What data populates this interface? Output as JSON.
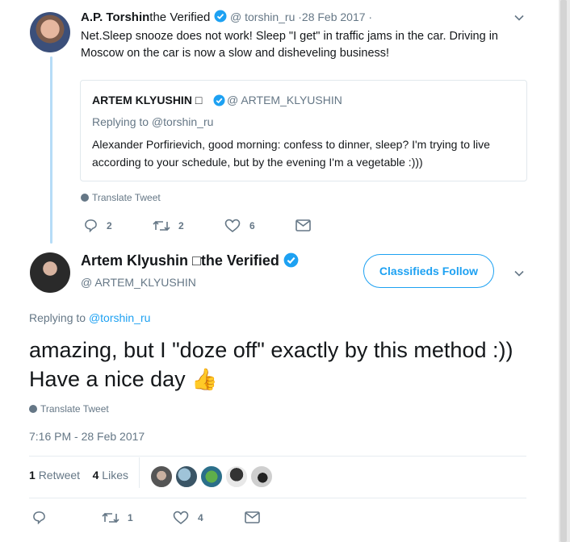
{
  "tweet1": {
    "author_name": "A.P. Torshin",
    "verified_label": "the Verified",
    "handle": "@ torshin_ru",
    "date": "·28 Feb 2017 ·",
    "text": "Net.Sleep snooze does not work! Sleep \"I get\" in traffic jams in the car. Driving in Moscow on the car is now a slow and disheveling business!",
    "quoted": {
      "author_name": "ARTEM KLYUSHIN □",
      "handle": "@ ARTEM_KLYUSHIN",
      "replying_to": "Replying to @torshin_ru",
      "text": "Alexander Porfirievich, good morning: confess to dinner, sleep? I'm trying to live according to your schedule, but by the evening I'm a vegetable :)))"
    },
    "translate_label": "Translate Tweet",
    "actions": {
      "replies": "2",
      "retweets": "2",
      "likes": "6"
    }
  },
  "tweet2": {
    "author_name": "Artem Klyushin □the Verified",
    "handle": "@ ARTEM_KLYUSHIN",
    "follow_label": "Classifieds Follow",
    "replying_prefix": "Replying to",
    "replying_handle": "@torshin_ru",
    "text": "amazing, but I \"doze off\" exactly by this method :)) Have a nice day",
    "emoji": "👍",
    "translate_label": "Translate Tweet",
    "timestamp": "7:16 PM - 28 Feb 2017",
    "stats": {
      "retweets_count": "1",
      "retweets_label": "Retweet",
      "likes_count": "4",
      "likes_label": "Likes"
    },
    "actions": {
      "retweets": "1",
      "likes": "4"
    }
  },
  "colors": {
    "accent": "#1da1f2",
    "muted": "#657786",
    "thread_line": "#b6dcf7",
    "text": "#14171a"
  }
}
